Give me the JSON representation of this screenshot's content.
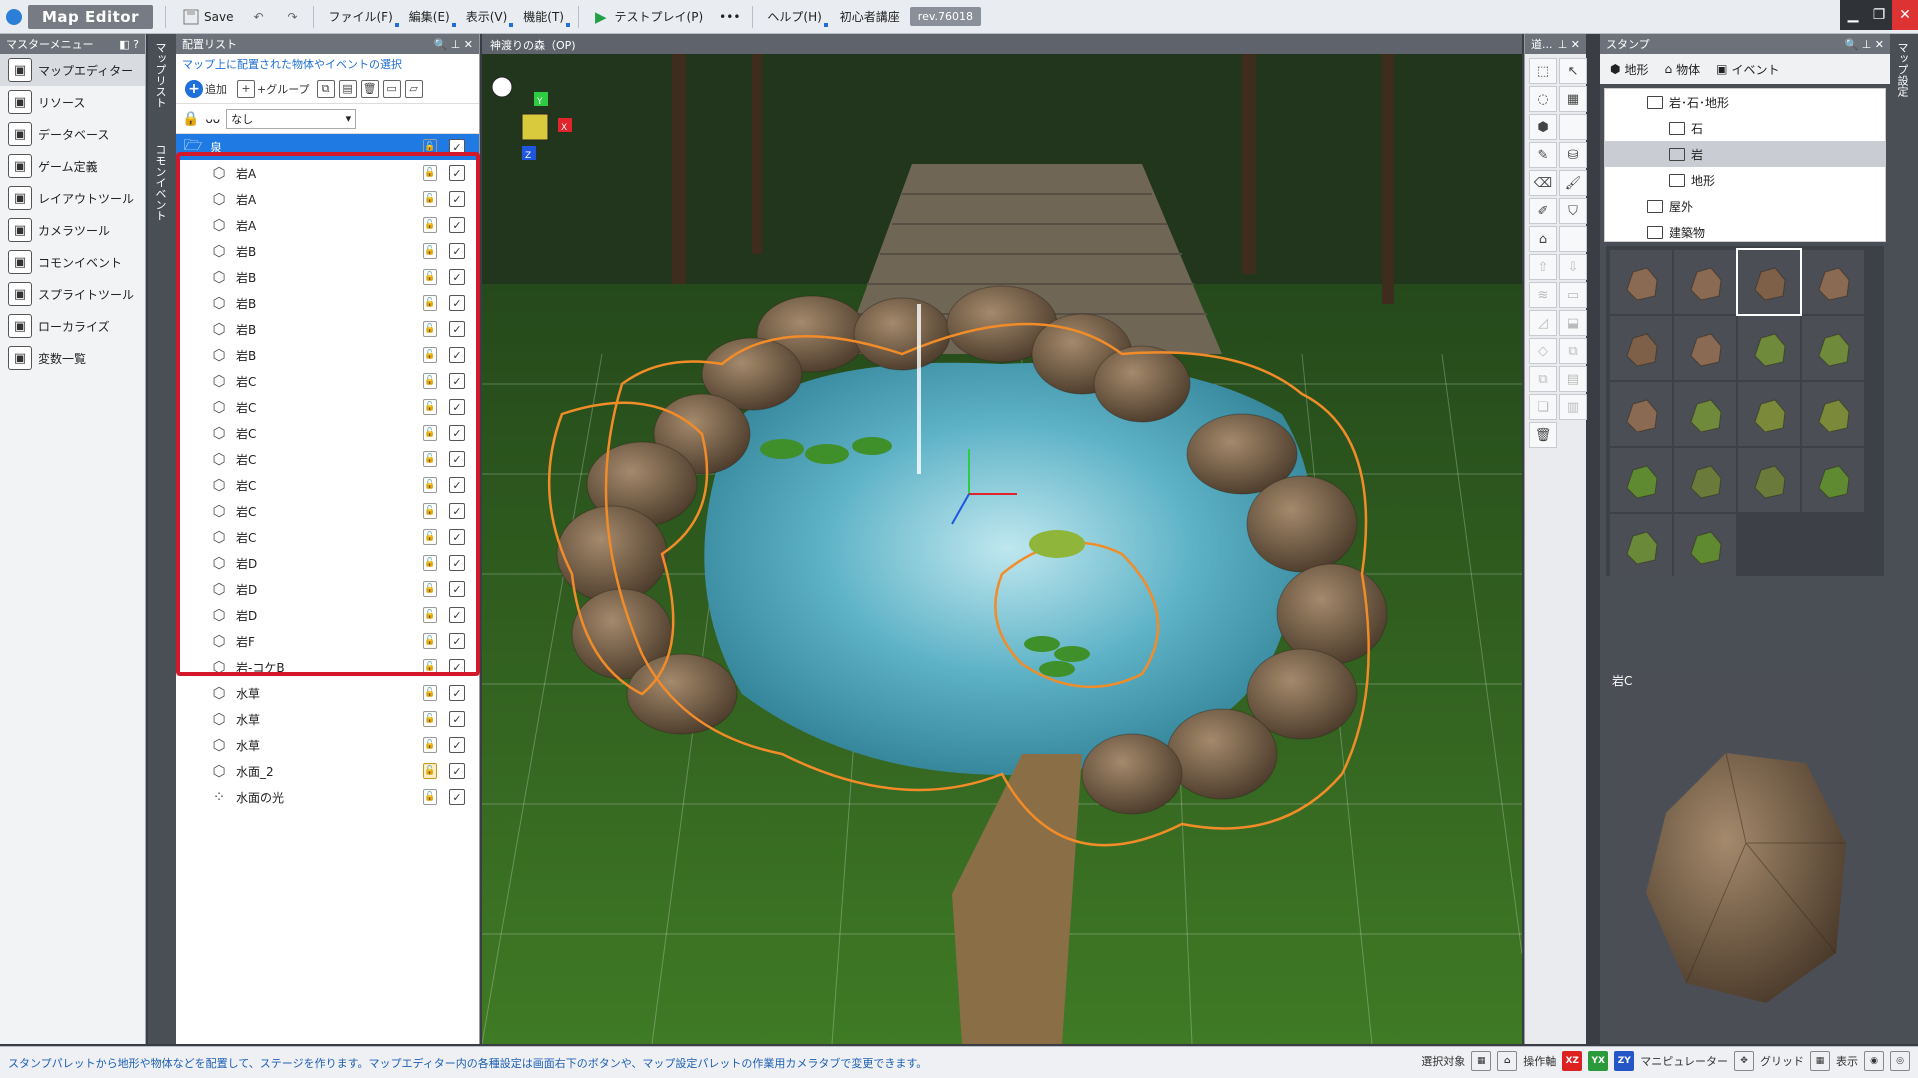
{
  "app": {
    "title": "Map Editor"
  },
  "toolbar": {
    "save_label": "Save",
    "menus": [
      "ファイル(F)",
      "編集(E)",
      "表示(V)",
      "機能(T)"
    ],
    "test_play_label": "テストプレイ(P)",
    "help_label": "ヘルプ(H)",
    "tutorial_label": "初心者講座",
    "revision": "rev.76018"
  },
  "master_menu": {
    "title": "マスターメニュー",
    "items": [
      {
        "label": "マップエディター",
        "icon": "map-editor-icon",
        "active": true
      },
      {
        "label": "リソース",
        "icon": "resource-icon"
      },
      {
        "label": "データベース",
        "icon": "database-icon"
      },
      {
        "label": "ゲーム定義",
        "icon": "game-definition-icon"
      },
      {
        "label": "レイアウトツール",
        "icon": "layout-tool-icon"
      },
      {
        "label": "カメラツール",
        "icon": "camera-tool-icon"
      },
      {
        "label": "コモンイベント",
        "icon": "common-event-icon"
      },
      {
        "label": "スプライトツール",
        "icon": "sprite-tool-icon"
      },
      {
        "label": "ローカライズ",
        "icon": "localize-icon"
      },
      {
        "label": "変数一覧",
        "icon": "variable-list-icon"
      }
    ]
  },
  "side_tabs": {
    "tab1": "マップリスト",
    "tab2": "コモンイベント"
  },
  "placement": {
    "title": "配置リスト",
    "hint": "マップ上に配置された物体やイベントの選択",
    "add_label": "追加",
    "group_label": "+グループ",
    "filter_value": "なし",
    "filter_prefix": "ᴗᴗ",
    "rows": [
      {
        "name": "泉",
        "type": "folder",
        "selected": true
      },
      {
        "name": "岩A"
      },
      {
        "name": "岩A"
      },
      {
        "name": "岩A"
      },
      {
        "name": "岩B"
      },
      {
        "name": "岩B"
      },
      {
        "name": "岩B"
      },
      {
        "name": "岩B"
      },
      {
        "name": "岩B"
      },
      {
        "name": "岩C"
      },
      {
        "name": "岩C"
      },
      {
        "name": "岩C"
      },
      {
        "name": "岩C"
      },
      {
        "name": "岩C"
      },
      {
        "name": "岩C"
      },
      {
        "name": "岩C"
      },
      {
        "name": "岩D"
      },
      {
        "name": "岩D"
      },
      {
        "name": "岩D"
      },
      {
        "name": "岩F"
      },
      {
        "name": "岩-コケB"
      },
      {
        "name": "水草"
      },
      {
        "name": "水草"
      },
      {
        "name": "水草"
      },
      {
        "name": "水面_2",
        "locked": true
      },
      {
        "name": "水面の光",
        "type": "particle"
      }
    ]
  },
  "viewport": {
    "title": "神渡りの森（OP)",
    "axis_x": "X",
    "axis_y": "Y",
    "axis_z": "Z"
  },
  "tools": {
    "title": "道..."
  },
  "stamp": {
    "title": "スタンプ",
    "tabs": [
      "地形",
      "物体",
      "イベント"
    ],
    "tree": [
      {
        "label": "岩･石･地形",
        "indent": 1
      },
      {
        "label": "石",
        "indent": 2
      },
      {
        "label": "岩",
        "indent": 2,
        "selected": true
      },
      {
        "label": "地形",
        "indent": 2
      },
      {
        "label": "屋外",
        "indent": 1
      },
      {
        "label": "建築物",
        "indent": 1
      }
    ],
    "selected_name": "岩C"
  },
  "right_strip": {
    "label": "マップ設定"
  },
  "status": {
    "message": "スタンプパレットから地形や物体などを配置して、ステージを作ります。マップエディター内の各種設定は画面右下のボタンや、マップ設定パレットの作業用カメラタブで変更できます。",
    "select_target": "選択対象",
    "operation": "操作軸",
    "xz": "XZ",
    "yx": "YX",
    "zy": "ZY",
    "manipulator": "マニピュレーター",
    "grid": "グリッド",
    "display": "表示"
  },
  "colors": {
    "accent": "#1f7be3",
    "highlight": "#d2182a",
    "selection_outline": "#f28c28"
  }
}
